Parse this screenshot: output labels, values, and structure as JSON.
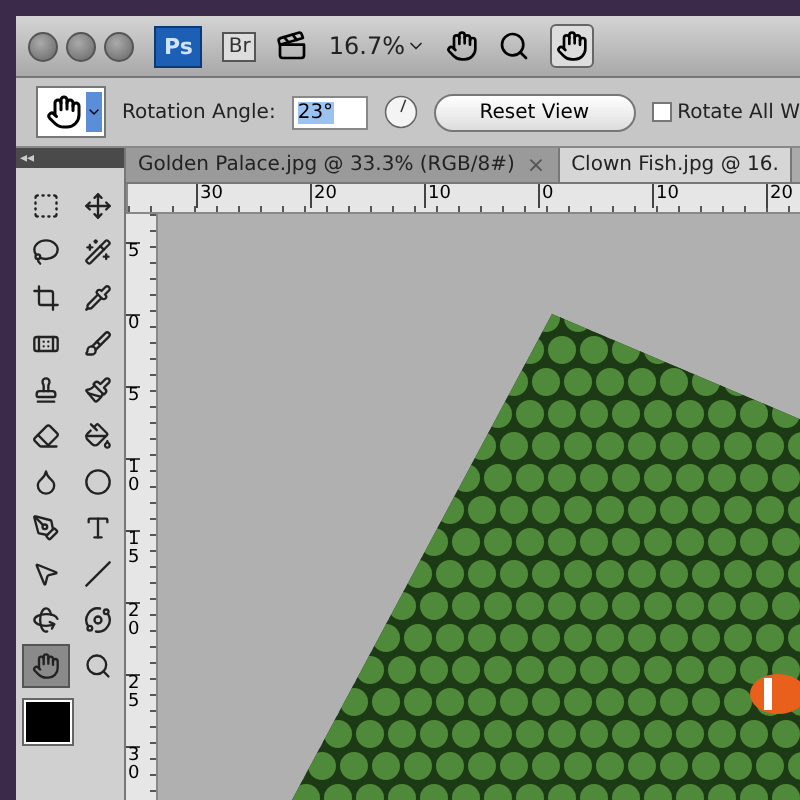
{
  "app_bar": {
    "app_badge": "Ps",
    "bridge_badge": "Br",
    "zoom": "16.7%"
  },
  "options_bar": {
    "angle_label": "Rotation Angle:",
    "angle_value": "23°",
    "reset_button": "Reset View",
    "rotate_all": {
      "label": "Rotate All W",
      "checked": false
    }
  },
  "toolbox": {
    "collapse": "◂◂"
  },
  "tools": [
    {
      "kind": "marquee",
      "selected": false
    },
    {
      "kind": "move",
      "selected": false
    },
    {
      "kind": "lasso",
      "selected": false
    },
    {
      "kind": "wand",
      "selected": false
    },
    {
      "kind": "crop",
      "selected": false
    },
    {
      "kind": "eyedropper",
      "selected": false
    },
    {
      "kind": "heal",
      "selected": false
    },
    {
      "kind": "brush",
      "selected": false
    },
    {
      "kind": "stamp",
      "selected": false
    },
    {
      "kind": "history",
      "selected": false
    },
    {
      "kind": "eraser",
      "selected": false
    },
    {
      "kind": "bucket",
      "selected": false
    },
    {
      "kind": "blur",
      "selected": false
    },
    {
      "kind": "dodge",
      "selected": false
    },
    {
      "kind": "pen",
      "selected": false
    },
    {
      "kind": "type",
      "selected": false
    },
    {
      "kind": "select",
      "selected": false
    },
    {
      "kind": "line",
      "selected": false
    },
    {
      "kind": "rotate3d",
      "selected": false
    },
    {
      "kind": "orbit",
      "selected": false
    },
    {
      "kind": "rotateview",
      "selected": true
    },
    {
      "kind": "zoom",
      "selected": false
    }
  ],
  "tabs": [
    {
      "label": "Golden Palace.jpg @ 33.3% (RGB/8#)",
      "close": "×",
      "selected": true
    },
    {
      "label": "Clown Fish.jpg @ 16.",
      "selected": false
    }
  ],
  "ruler": {
    "horizontal": [
      "30",
      "20",
      "10",
      "0",
      "10",
      "20"
    ],
    "vertical": [
      "5",
      "0",
      "5",
      "10",
      "15",
      "20",
      "25",
      "30"
    ]
  }
}
